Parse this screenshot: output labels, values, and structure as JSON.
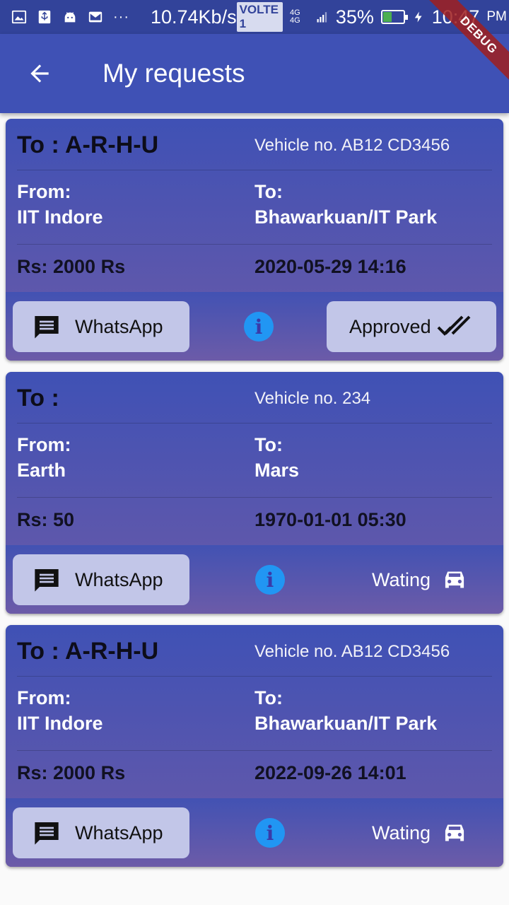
{
  "status_bar": {
    "speed": "10.74Kb/s",
    "volte": "VOLTE 1",
    "network": "4G 4G",
    "battery_percent": "35%",
    "battery_level": 0.35,
    "time": "10:47",
    "ampm": "PM",
    "dots": "···"
  },
  "debug_banner": "DEBUG",
  "app_bar": {
    "title": "My requests",
    "back_icon": "arrow-back-icon"
  },
  "requests": [
    {
      "to_heading": "To : A-R-H-U",
      "vehicle": "Vehicle no. AB12 CD3456",
      "from_label": "From:",
      "from_value": "IIT Indore",
      "to_label": "To:",
      "to_value": "Bhawarkuan/IT Park",
      "price": "Rs: 2000 Rs",
      "datetime": "2020-05-29 14:16",
      "whatsapp_label": "WhatsApp",
      "status": "Approved",
      "status_icon": "done-all-icon"
    },
    {
      "to_heading": "To :",
      "vehicle": "Vehicle no. 234",
      "from_label": "From:",
      "from_value": "Earth",
      "to_label": "To:",
      "to_value": "Mars",
      "price": "Rs: 50",
      "datetime": "1970-01-01 05:30",
      "whatsapp_label": "WhatsApp",
      "status": "Wating",
      "status_icon": "car-icon"
    },
    {
      "to_heading": "To : A-R-H-U",
      "vehicle": "Vehicle no. AB12 CD3456",
      "from_label": "From:",
      "from_value": "IIT Indore",
      "to_label": "To:",
      "to_value": "Bhawarkuan/IT Park",
      "price": "Rs: 2000 Rs",
      "datetime": "2022-09-26 14:01",
      "whatsapp_label": "WhatsApp",
      "status": "Wating",
      "status_icon": "car-icon"
    }
  ],
  "colors": {
    "primary": "#3f51b5",
    "primary_dark": "#32439a",
    "info_blue": "#2196f3",
    "button_bg": "#c2c6e8"
  }
}
